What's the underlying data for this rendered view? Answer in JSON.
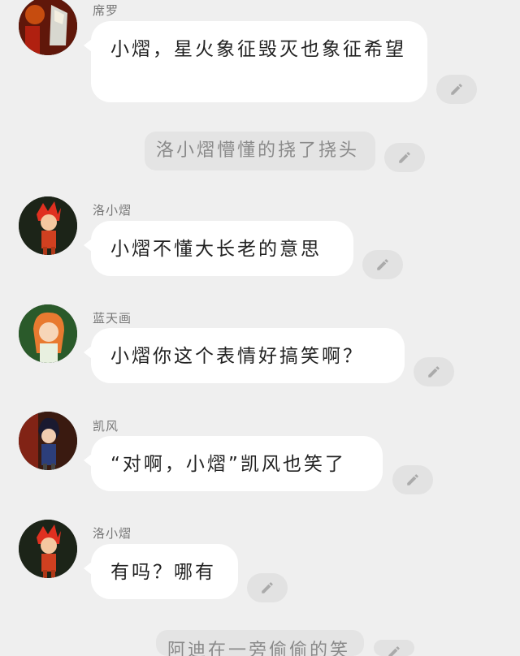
{
  "messages": [
    {
      "name": "席罗",
      "text": "小熠，星火象征毁灭也象征希望"
    },
    {
      "narration": "洛小熠懵懂的挠了挠头"
    },
    {
      "name": "洛小熠",
      "text": "小熠不懂大长老的意思"
    },
    {
      "name": "蓝天画",
      "text": "小熠你这个表情好搞笑啊？"
    },
    {
      "name": "凯风",
      "text": "“对啊，小熠”凯风也笑了"
    },
    {
      "name": "洛小熠",
      "text": "有吗？哪有"
    },
    {
      "narration": "阿迪在一旁偷偷的笑"
    }
  ],
  "icons": {
    "edit": "pencil-icon"
  },
  "colors": {
    "background": "#efefef",
    "bubble": "#ffffff",
    "edit_button": "#e2e2e2",
    "narration_bg": "#e4e4e4"
  }
}
